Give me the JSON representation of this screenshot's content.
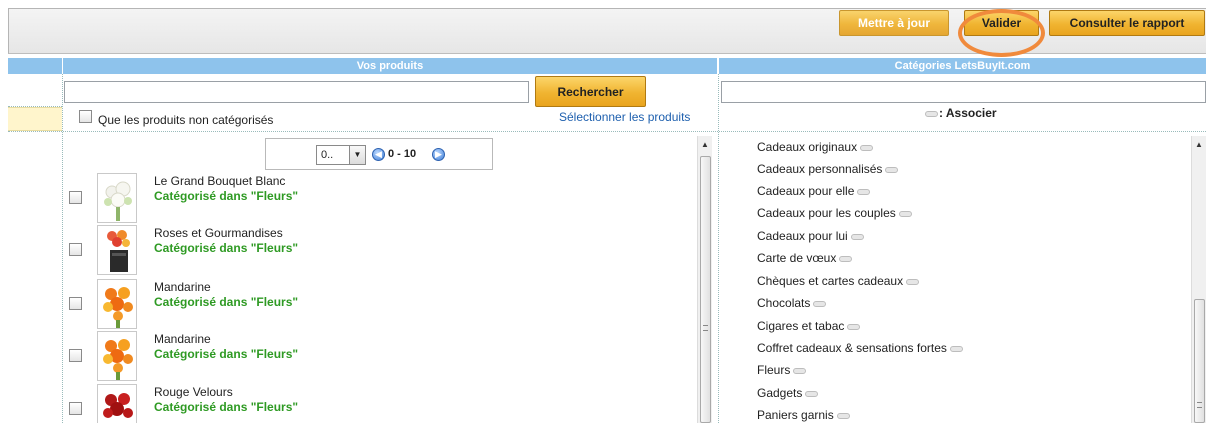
{
  "toolbar": {
    "update_label": "Mettre à jour",
    "validate_label": "Valider",
    "report_label": "Consulter le rapport"
  },
  "products_panel": {
    "title": "Vos produits",
    "search_value": "",
    "search_button": "Rechercher",
    "uncategorized_label": "Que les produits non catégorisés",
    "select_products_link": "Sélectionner les produits",
    "pager": {
      "per_page": "0..",
      "range": "0 - 10"
    },
    "items": [
      {
        "name": "Le Grand Bouquet Blanc",
        "category": "Catégorisé dans \"Fleurs\""
      },
      {
        "name": "Roses et Gourmandises",
        "category": "Catégorisé dans \"Fleurs\""
      },
      {
        "name": "Mandarine",
        "category": "Catégorisé dans \"Fleurs\""
      },
      {
        "name": "Mandarine",
        "category": "Catégorisé dans \"Fleurs\""
      },
      {
        "name": "Rouge Velours",
        "category": "Catégorisé dans \"Fleurs\""
      }
    ]
  },
  "categories_panel": {
    "title": "Catégories LetsBuyIt.com",
    "search_value": "",
    "associate_label": ": Associer",
    "items": [
      "Cadeaux originaux",
      "Cadeaux personnalisés",
      "Cadeaux pour elle",
      "Cadeaux pour les couples",
      "Cadeaux pour lui",
      "Carte de vœux",
      "Chèques et cartes cadeaux",
      "Chocolats",
      "Cigares et tabac",
      "Coffret cadeaux & sensations fortes",
      "Fleurs",
      "Gadgets",
      "Paniers garnis"
    ]
  },
  "colors": {
    "header_blue": "#8ec3ec",
    "button_gold": "#f0b431",
    "highlight_orange": "#f08a3c",
    "category_green": "#2e9a23",
    "link_blue": "#1d5fae"
  }
}
